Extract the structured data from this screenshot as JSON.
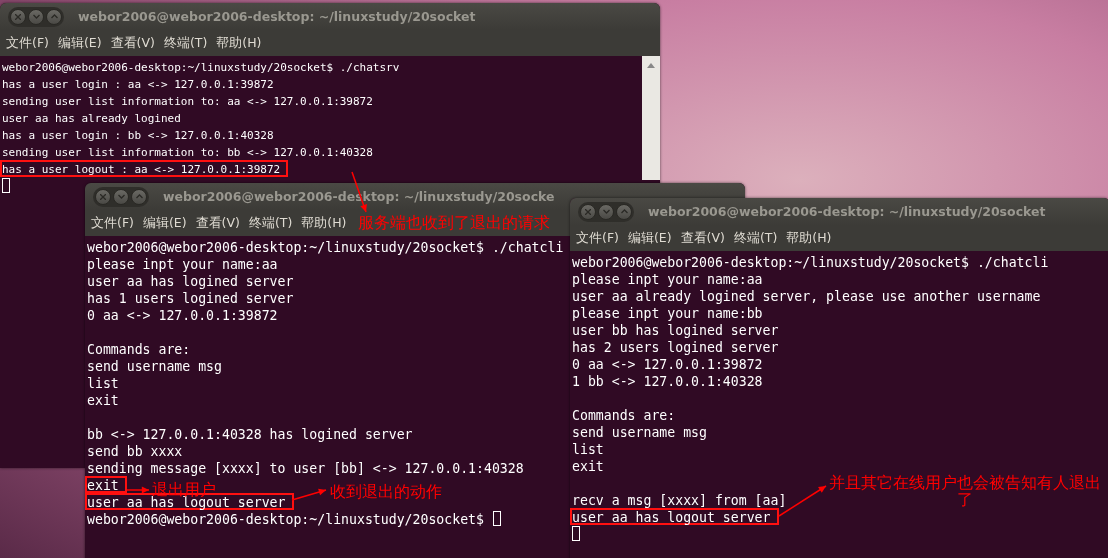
{
  "windows": [
    {
      "title": "webor2006@webor2006-desktop: ~/linuxstudy/20socket",
      "menu": [
        "文件(F)",
        "编辑(E)",
        "查看(V)",
        "终端(T)",
        "帮助(H)"
      ],
      "scrollbar": true,
      "lines": [
        {
          "kind": "text",
          "text": "webor2006@webor2006-desktop:~/linuxstudy/20socket$ ./chatsrv",
          "highlighted": false,
          "cursor": false
        },
        {
          "kind": "text",
          "text": "has a user login : aa <-> 127.0.0.1:39872",
          "highlighted": false,
          "cursor": false
        },
        {
          "kind": "text",
          "text": "sending user list information to: aa <-> 127.0.0.1:39872",
          "highlighted": false,
          "cursor": false
        },
        {
          "kind": "text",
          "text": "user aa has already logined",
          "highlighted": false,
          "cursor": false
        },
        {
          "kind": "text",
          "text": "has a user login : bb <-> 127.0.0.1:40328",
          "highlighted": false,
          "cursor": false
        },
        {
          "kind": "text",
          "text": "sending user list information to: bb <-> 127.0.0.1:40328",
          "highlighted": false,
          "cursor": false
        },
        {
          "kind": "text",
          "text": "has a user logout : aa <-> 127.0.0.1:39872",
          "highlighted": true,
          "cursor": false
        },
        {
          "kind": "cursor"
        }
      ]
    },
    {
      "title": "webor2006@webor2006-desktop: ~/linuxstudy/20socke",
      "menu": [
        "文件(F)",
        "编辑(E)",
        "查看(V)",
        "终端(T)",
        "帮助(H)"
      ],
      "lines": [
        {
          "kind": "text",
          "text": "webor2006@webor2006-desktop:~/linuxstudy/20socket$ ./chatcli",
          "highlighted": false,
          "cursor": false
        },
        {
          "kind": "text",
          "text": "please inpt your name:aa",
          "highlighted": false,
          "cursor": false
        },
        {
          "kind": "text",
          "text": "user aa has logined server",
          "highlighted": false,
          "cursor": false
        },
        {
          "kind": "text",
          "text": "has 1 users logined server",
          "highlighted": false,
          "cursor": false
        },
        {
          "kind": "text",
          "text": "0 aa <-> 127.0.0.1:39872",
          "highlighted": false,
          "cursor": false
        },
        {
          "kind": "blank"
        },
        {
          "kind": "text",
          "text": "Commands are:",
          "highlighted": false,
          "cursor": false
        },
        {
          "kind": "text",
          "text": "send username msg",
          "highlighted": false,
          "cursor": false
        },
        {
          "kind": "text",
          "text": "list",
          "highlighted": false,
          "cursor": false
        },
        {
          "kind": "text",
          "text": "exit",
          "highlighted": false,
          "cursor": false
        },
        {
          "kind": "blank"
        },
        {
          "kind": "text",
          "text": "bb <-> 127.0.0.1:40328 has logined server",
          "highlighted": false,
          "cursor": false
        },
        {
          "kind": "text",
          "text": "send bb xxxx",
          "highlighted": false,
          "cursor": false
        },
        {
          "kind": "text",
          "text": "sending message [xxxx] to user [bb] <-> 127.0.0.1:40328",
          "highlighted": false,
          "cursor": false
        },
        {
          "kind": "text",
          "text": "exit",
          "highlighted": true,
          "cursor": false
        },
        {
          "kind": "text",
          "text": "user aa has logout server",
          "highlighted": true,
          "cursor": false
        },
        {
          "kind": "text",
          "text": "webor2006@webor2006-desktop:~/linuxstudy/20socket$",
          "highlighted": false,
          "cursor": true
        }
      ]
    },
    {
      "title": "webor2006@webor2006-desktop: ~/linuxstudy/20socket",
      "menu": [
        "文件(F)",
        "编辑(E)",
        "查看(V)",
        "终端(T)",
        "帮助(H)"
      ],
      "lines": [
        {
          "kind": "text",
          "text": "webor2006@webor2006-desktop:~/linuxstudy/20socket$ ./chatcli",
          "highlighted": false,
          "cursor": false
        },
        {
          "kind": "text",
          "text": "please inpt your name:aa",
          "highlighted": false,
          "cursor": false
        },
        {
          "kind": "text",
          "text": "user aa already logined server, please use another username",
          "highlighted": false,
          "cursor": false
        },
        {
          "kind": "text",
          "text": "please inpt your name:bb",
          "highlighted": false,
          "cursor": false
        },
        {
          "kind": "text",
          "text": "user bb has logined server",
          "highlighted": false,
          "cursor": false
        },
        {
          "kind": "text",
          "text": "has 2 users logined server",
          "highlighted": false,
          "cursor": false
        },
        {
          "kind": "text",
          "text": "0 aa <-> 127.0.0.1:39872",
          "highlighted": false,
          "cursor": false
        },
        {
          "kind": "text",
          "text": "1 bb <-> 127.0.0.1:40328",
          "highlighted": false,
          "cursor": false
        },
        {
          "kind": "blank"
        },
        {
          "kind": "text",
          "text": "Commands are:",
          "highlighted": false,
          "cursor": false
        },
        {
          "kind": "text",
          "text": "send username msg",
          "highlighted": false,
          "cursor": false
        },
        {
          "kind": "text",
          "text": "list",
          "highlighted": false,
          "cursor": false
        },
        {
          "kind": "text",
          "text": "exit",
          "highlighted": false,
          "cursor": false
        },
        {
          "kind": "blank"
        },
        {
          "kind": "text",
          "text": "recv a msg [xxxx] from [aa]",
          "highlighted": false,
          "cursor": false
        },
        {
          "kind": "text",
          "text": "user aa has logout server",
          "highlighted": true,
          "cursor": false
        },
        {
          "kind": "cursor"
        }
      ]
    }
  ],
  "annotations": [
    {
      "text": "服务端也收到了退出的请求"
    },
    {
      "text": "退出用户"
    },
    {
      "text": "收到退出的动作"
    },
    {
      "text": "并且其它在线用户也会被告知有人退出了"
    }
  ]
}
